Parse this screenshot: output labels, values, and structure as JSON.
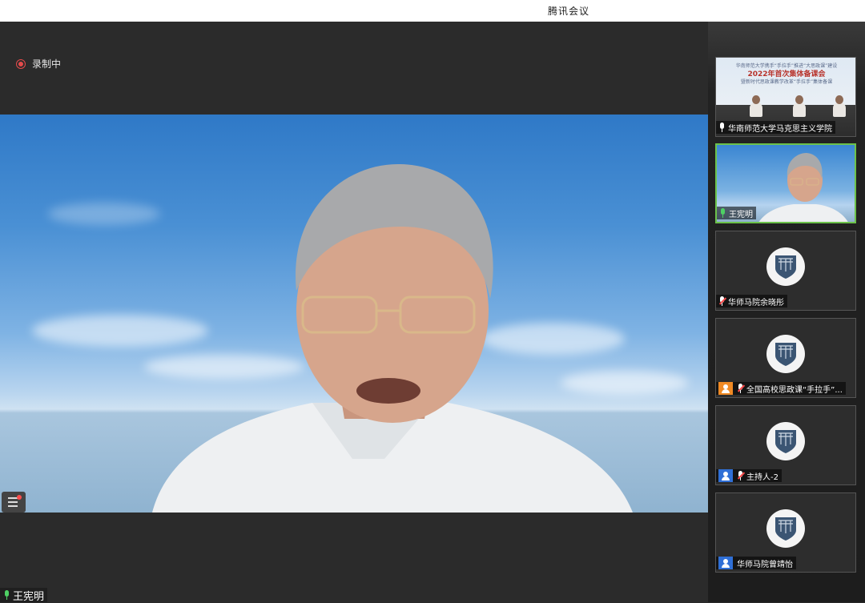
{
  "window": {
    "title": "腾讯会议"
  },
  "stage": {
    "recording_label": "录制中",
    "speaker_name": "王宪明"
  },
  "participants": [
    {
      "name": "华南师范大学马克思主义学院",
      "mic": "on",
      "type": "conference",
      "banner_top": "华南师范大学携手“手拉手”推进“大思政课”建设",
      "banner_main": "2022年首次集体备课会",
      "banner_sub": "暨新时代思政课教学改革“手拉手”集体备课"
    },
    {
      "name": "王宪明",
      "mic": "speaking",
      "type": "video",
      "active": true
    },
    {
      "name": "华师马院余晓彤",
      "mic": "muted",
      "type": "logo"
    },
    {
      "name": "全国高校思政课“手拉手”...",
      "mic": "muted",
      "type": "logo",
      "badge": "orange"
    },
    {
      "name": "主持人-2",
      "mic": "muted",
      "type": "logo",
      "badge": "blue"
    },
    {
      "name": "华师马院曾靖怡",
      "mic": "none",
      "type": "logo",
      "badge": "blue"
    }
  ],
  "colors": {
    "accent_green": "#6cc24a",
    "record_red": "#e54b4b",
    "stage_bg": "#2b2b2b"
  }
}
